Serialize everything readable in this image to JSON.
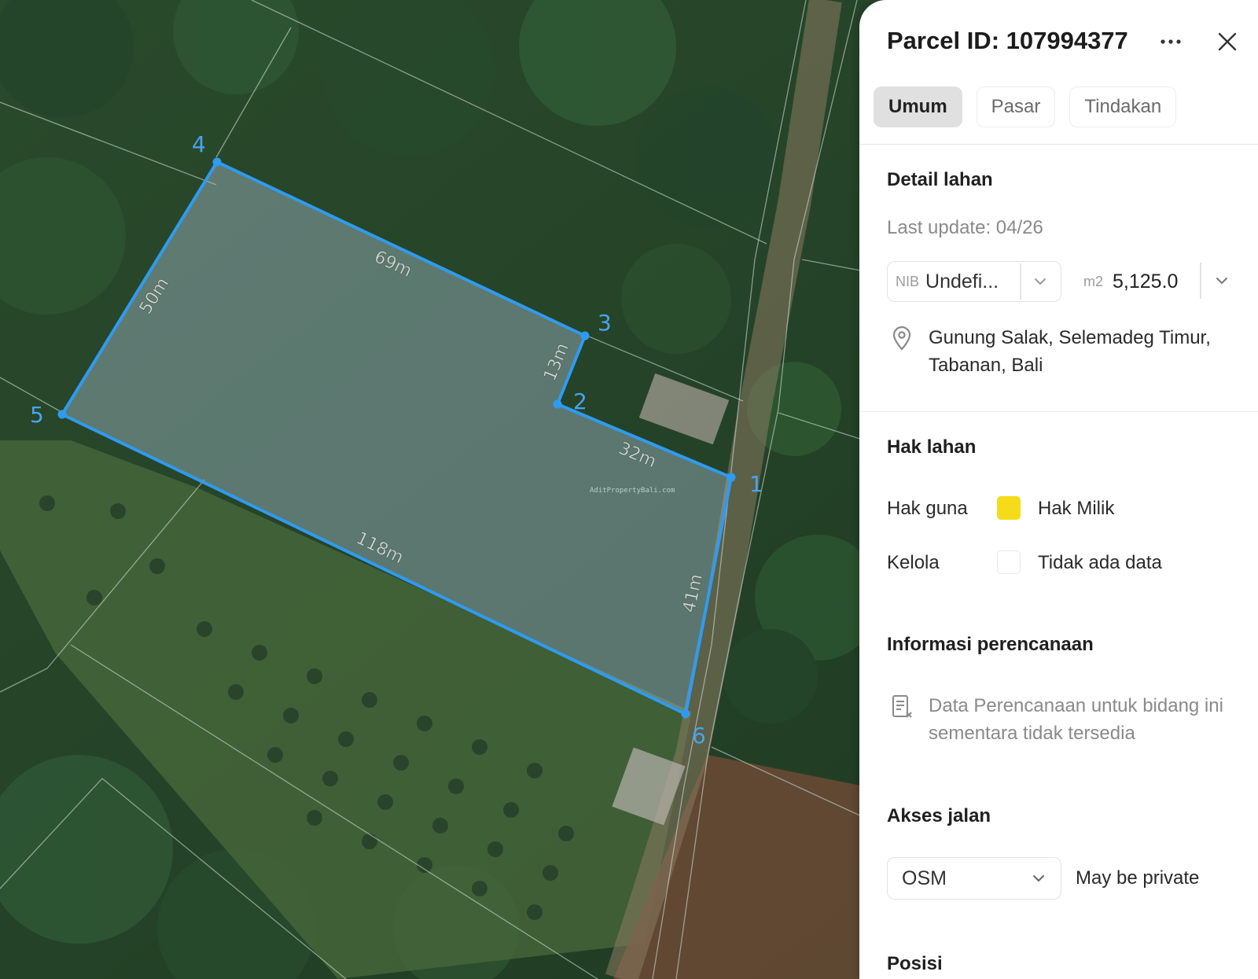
{
  "map": {
    "vertices": [
      {
        "label": "1"
      },
      {
        "label": "2"
      },
      {
        "label": "3"
      },
      {
        "label": "4"
      },
      {
        "label": "5"
      },
      {
        "label": "6"
      }
    ],
    "edges": [
      {
        "label": "32m"
      },
      {
        "label": "13m"
      },
      {
        "label": "69m"
      },
      {
        "label": "50m"
      },
      {
        "label": "118m"
      },
      {
        "label": "41m"
      }
    ],
    "watermark": "AditPropertyBali.com",
    "colors": {
      "parcel_outline": "#2f9bf0",
      "parcel_fill": "#9fb9c7"
    }
  },
  "panel": {
    "title": "Parcel ID: 107994377",
    "more_icon": "ellipsis-icon",
    "close_icon": "close-icon",
    "tabs": [
      {
        "label": "Umum",
        "active": true
      },
      {
        "label": "Pasar",
        "active": false
      },
      {
        "label": "Tindakan",
        "active": false
      }
    ],
    "detail": {
      "title": "Detail lahan",
      "last_update": "Last update: 04/26",
      "nib_prefix": "NIB",
      "nib_value": "Undefi...",
      "area_unit": "m2",
      "area_value": "5,125.0",
      "location": "Gunung Salak, Selemadeg Timur, Tabanan, Bali"
    },
    "rights": {
      "title": "Hak lahan",
      "rows": [
        {
          "label": "Hak guna",
          "value": "Hak Milik",
          "color": "#f5dc1a"
        },
        {
          "label": "Kelola",
          "value": "Tidak ada data",
          "color": "#ffffff"
        }
      ]
    },
    "planning": {
      "title": "Informasi perencanaan",
      "note": "Data Perencanaan untuk bidang ini sementara tidak tersedia"
    },
    "access": {
      "title": "Akses jalan",
      "source": "OSM",
      "note": "May be private"
    },
    "position": {
      "title": "Posisi"
    }
  }
}
